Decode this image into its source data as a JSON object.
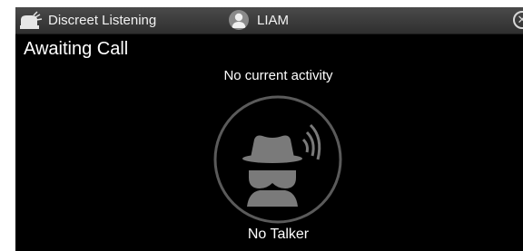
{
  "titlebar": {
    "app_title": "Discreet Listening",
    "app_icon": "headset-speaker-icon",
    "user_icon": "user-avatar-icon",
    "user_name": "LIAM",
    "close_icon": "close-icon",
    "close_glyph": "✕"
  },
  "main": {
    "status_title": "Awaiting Call",
    "activity_text": "No current activity",
    "listen_icon": "incognito-listener-icon",
    "talker_text": "No Talker"
  },
  "colors": {
    "background": "#000000",
    "titlebar": "#3a3a3a",
    "text": "#ffffff",
    "ring": "#5a5a5a",
    "icon": "#7a7a7a"
  }
}
